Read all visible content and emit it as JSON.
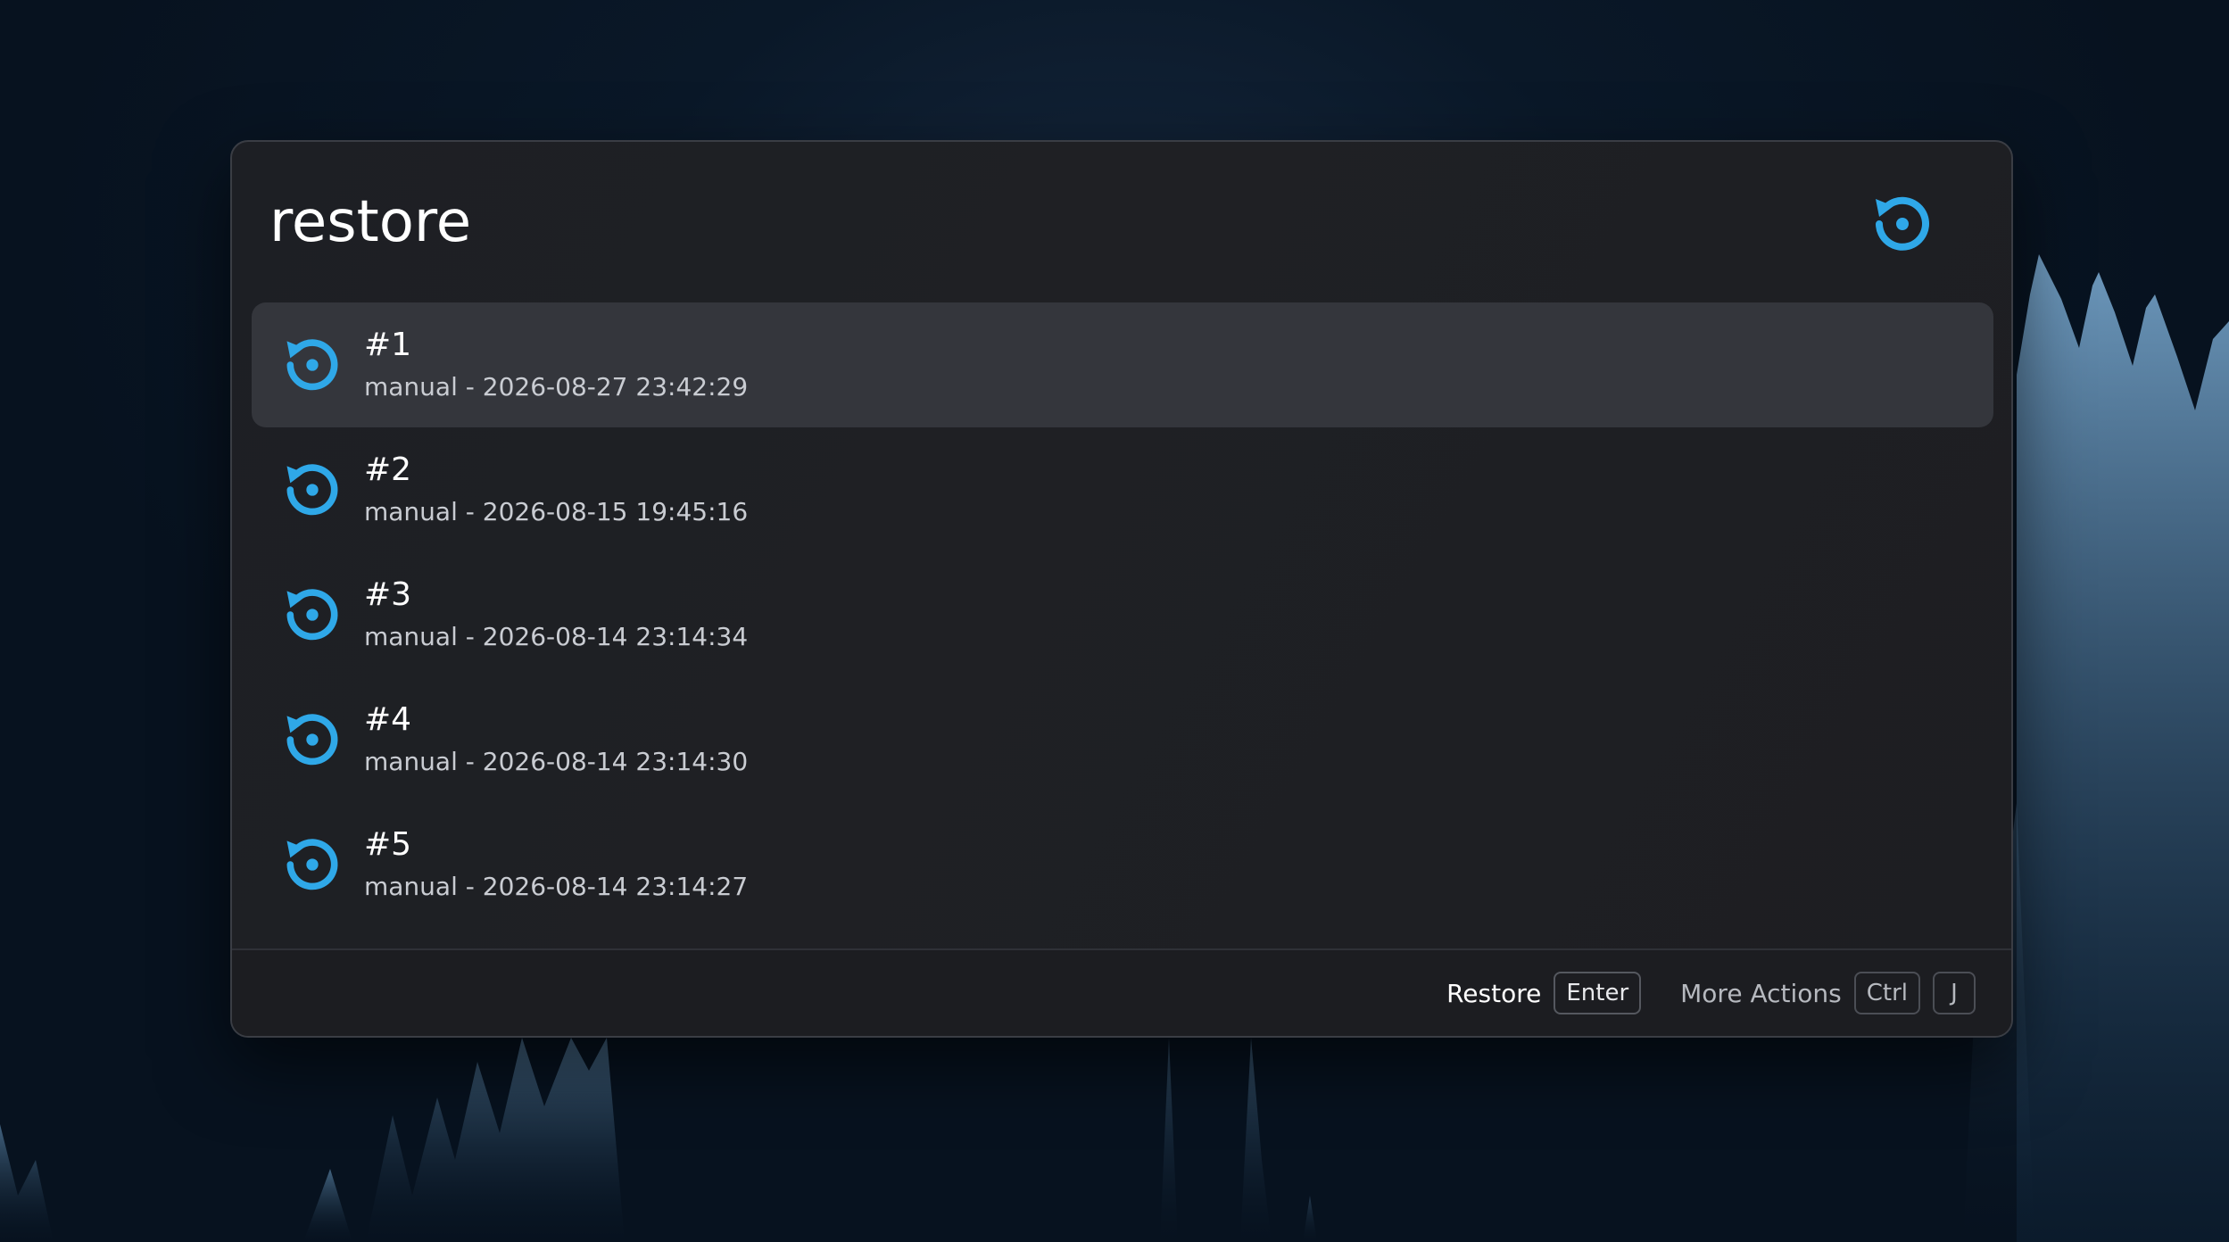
{
  "search": {
    "value": "restore"
  },
  "header_icon": "restore-icon",
  "accent_color": "#2fa8e8",
  "results": [
    {
      "title": "#1",
      "subtitle": "manual - 2026-08-27 23:42:29",
      "icon": "restore-icon",
      "selected": true
    },
    {
      "title": "#2",
      "subtitle": "manual - 2026-08-15 19:45:16",
      "icon": "restore-icon",
      "selected": false
    },
    {
      "title": "#3",
      "subtitle": "manual - 2026-08-14 23:14:34",
      "icon": "restore-icon",
      "selected": false
    },
    {
      "title": "#4",
      "subtitle": "manual - 2026-08-14 23:14:30",
      "icon": "restore-icon",
      "selected": false
    },
    {
      "title": "#5",
      "subtitle": "manual - 2026-08-14 23:14:27",
      "icon": "restore-icon",
      "selected": false
    }
  ],
  "footer": {
    "primary_action": "Restore",
    "primary_key": "Enter",
    "more_actions": "More Actions",
    "more_keys": [
      "Ctrl",
      "J"
    ]
  }
}
